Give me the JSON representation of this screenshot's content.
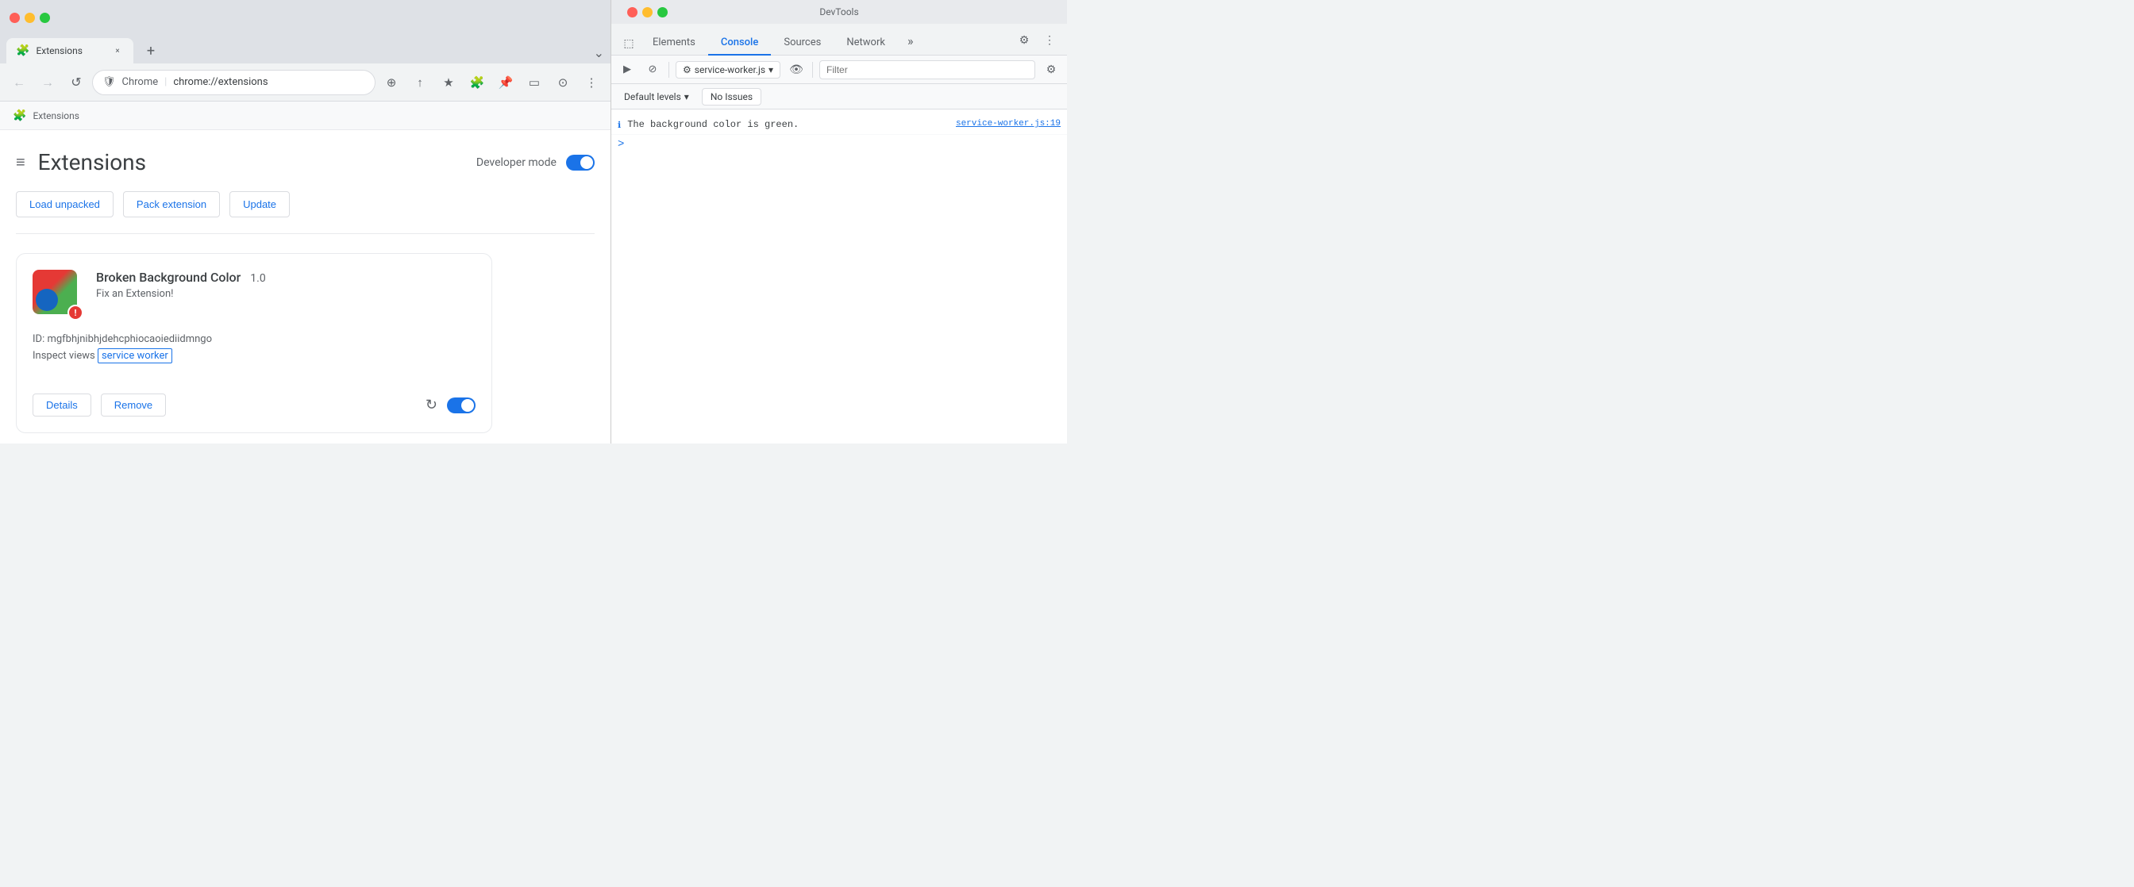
{
  "browser": {
    "window_title": "Extensions",
    "traffic_lights": {
      "red": "#ff5f57",
      "yellow": "#ffbd2e",
      "green": "#28c840"
    },
    "tab": {
      "icon": "🧩",
      "title": "Extensions",
      "close": "×"
    },
    "tab_new_label": "+",
    "tab_menu_label": "⌄",
    "nav": {
      "back_label": "←",
      "forward_label": "→",
      "reload_label": "↺"
    },
    "omnibox": {
      "brand": "Chrome",
      "separator": "|",
      "url": "chrome://extensions",
      "search_icon": "🔍",
      "zoom_icon": "⊕",
      "share_icon": "↑",
      "star_icon": "★",
      "ext_icon": "🧩",
      "pushpin_icon": "📌",
      "cast_icon": "▭",
      "profile_icon": "⊙",
      "menu_icon": "⋮"
    },
    "breadcrumb": {
      "icon": "🧩",
      "label": "Extensions"
    },
    "page": {
      "hamburger": "≡",
      "title": "Extensions",
      "search_icon": "🔍",
      "dev_mode_label": "Developer mode"
    },
    "action_buttons": [
      {
        "label": "Load unpacked",
        "id": "load-unpacked"
      },
      {
        "label": "Pack extension",
        "id": "pack-extension"
      },
      {
        "label": "Update",
        "id": "update"
      }
    ],
    "extension_card": {
      "name": "Broken Background Color",
      "version": "1.0",
      "description": "Fix an Extension!",
      "id_label": "ID: mgfbhjnibhjdehcphiocaoiediidmngo",
      "inspect_label": "Inspect views",
      "inspect_link_text": "service worker",
      "details_btn": "Details",
      "remove_btn": "Remove"
    }
  },
  "devtools": {
    "title": "DevTools",
    "traffic_lights": {
      "close": "●",
      "minimize": "●",
      "maximize": "●"
    },
    "tabs": [
      {
        "label": "Elements",
        "active": false
      },
      {
        "label": "Console",
        "active": true
      },
      {
        "label": "Sources",
        "active": false
      },
      {
        "label": "Network",
        "active": false
      }
    ],
    "tab_more_label": "»",
    "toolbar": {
      "play_icon": "▶",
      "block_icon": "⊘",
      "source_label": "service-worker.js",
      "source_dropdown": "▾",
      "eye_icon": "👁",
      "filter_placeholder": "Filter",
      "settings_icon": "⚙"
    },
    "secondary_toolbar": {
      "levels_label": "Default levels",
      "levels_arrow": "▾",
      "issues_label": "No Issues"
    },
    "console_output": {
      "log_text": "The background color is green.",
      "log_source": "service-worker.js:19",
      "prompt_arrow": ">"
    }
  }
}
